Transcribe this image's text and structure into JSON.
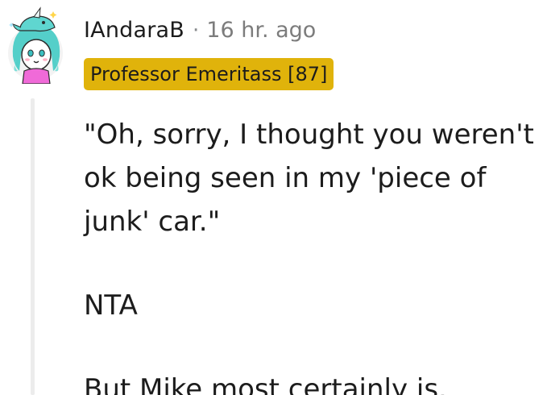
{
  "comment": {
    "username": "IAndaraB",
    "separator": "·",
    "timestamp": "16 hr. ago",
    "flair": "Professor Emeritass [87]",
    "avatar_icon": "snoo-avatar-narwhal-hat-icon",
    "paragraphs": [
      "\"Oh, sorry, I thought you weren't ok being seen in my 'piece of junk' car.\"",
      "NTA",
      "But Mike most certainly is."
    ]
  },
  "colors": {
    "flair_bg": "#e0b30b",
    "text": "#1c1c1c",
    "meta": "#7c7c7c",
    "thread_line": "#ececec"
  }
}
